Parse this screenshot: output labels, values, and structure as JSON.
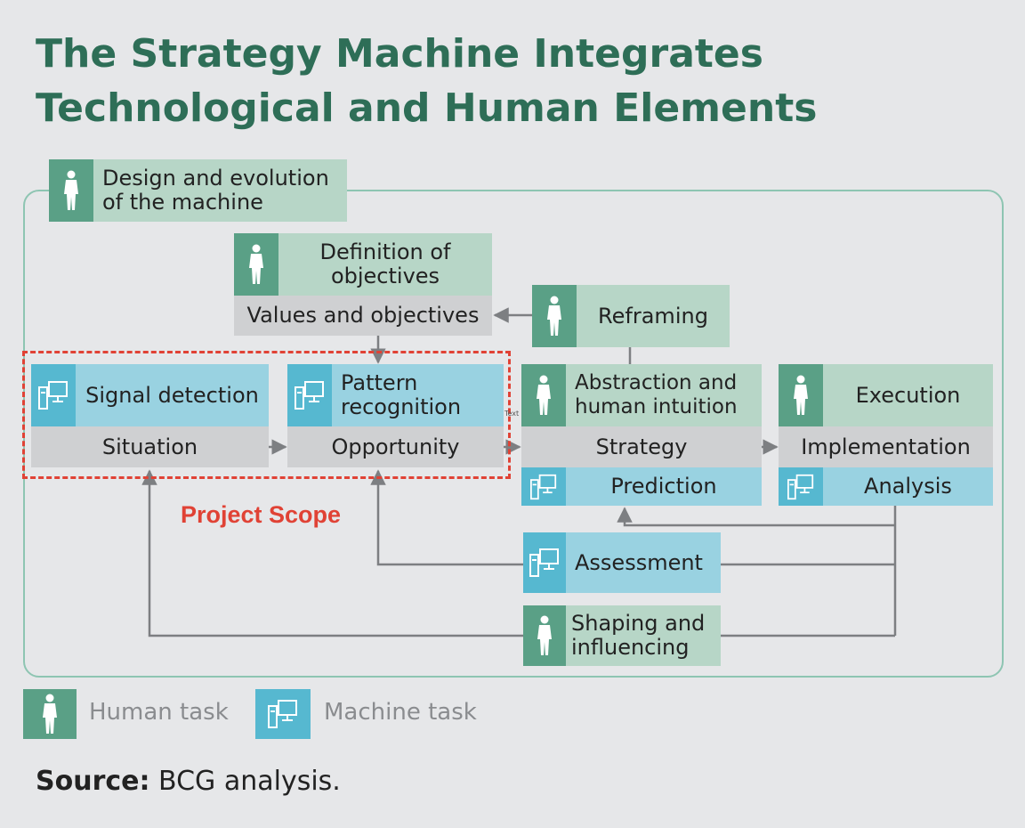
{
  "title_line1": "The Strategy Machine Integrates",
  "title_line2": "Technological and Human Elements",
  "nodes": {
    "design": {
      "line1": "Design and evolution",
      "line2": "of the machine"
    },
    "definition": {
      "line1": "Definition of",
      "line2": "objectives"
    },
    "values": "Values and objectives",
    "reframing": "Reframing",
    "signal_detection": "Signal detection",
    "situation": "Situation",
    "pattern": {
      "line1": "Pattern",
      "line2": "recognition"
    },
    "opportunity": "Opportunity",
    "abstraction": {
      "line1": "Abstraction and",
      "line2": "human intuition"
    },
    "strategy": "Strategy",
    "prediction": "Prediction",
    "execution": "Execution",
    "implementation": "Implementation",
    "analysis": "Analysis",
    "assessment": "Assessment",
    "shaping": {
      "line1": "Shaping and",
      "line2": "influencing"
    }
  },
  "scope_label": "Project Scope",
  "tiny_text": "Text",
  "legend": {
    "human": "Human task",
    "machine": "Machine task"
  },
  "source": {
    "label": "Source:",
    "text": "BCG analysis."
  },
  "colors": {
    "title": "#2e6e57",
    "human_icon": "#5aa086",
    "machine_icon": "#56b8d0",
    "human_label": "#b7d6c7",
    "machine_label": "#99d2e1",
    "grey_label": "#cfd0d2",
    "scope": "#e04235"
  }
}
